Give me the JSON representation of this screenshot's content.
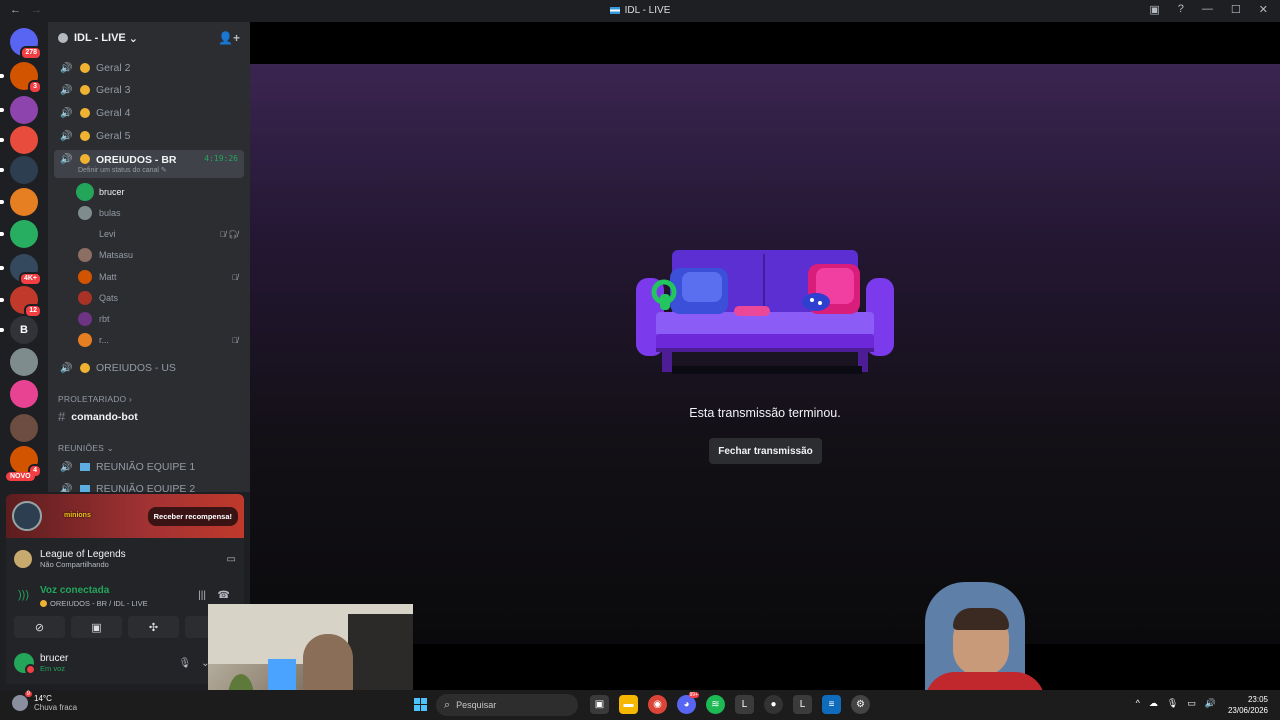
{
  "window": {
    "title": "IDL - LIVE",
    "back": "←",
    "forward": "→"
  },
  "servers": [
    {
      "label": "",
      "badge": "278",
      "color": "#5865f2"
    },
    {
      "label": "",
      "badge": "3",
      "color": "#d35400"
    },
    {
      "label": "",
      "badge": "",
      "color": "#8e44ad"
    },
    {
      "label": "",
      "badge": "",
      "color": "#e74c3c"
    },
    {
      "label": "",
      "badge": "",
      "color": "#2c3e50"
    },
    {
      "label": "",
      "badge": "",
      "color": "#e67e22"
    },
    {
      "label": "",
      "badge": "",
      "color": "#27ae60"
    },
    {
      "label": "",
      "badge": "4K+",
      "color": "#34495e"
    },
    {
      "label": "",
      "badge": "12",
      "color": "#c0392b"
    },
    {
      "label": "B",
      "badge": "",
      "color": "#313338"
    },
    {
      "label": "",
      "badge": "",
      "color": "#7f8c8d"
    },
    {
      "label": "",
      "badge": "",
      "color": "#e84393"
    },
    {
      "label": "",
      "badge": "",
      "color": "#6d4c41"
    },
    {
      "label": "",
      "badge": "4",
      "color": "#d35400"
    }
  ],
  "servers_new_label": "NOVO",
  "guild": {
    "name": "IDL - LIVE",
    "chevron": "⌄"
  },
  "voice_channels": [
    {
      "name": "Geral 2"
    },
    {
      "name": "Geral 3"
    },
    {
      "name": "Geral 4"
    },
    {
      "name": "Geral 5"
    }
  ],
  "active_channel": {
    "name": "OREIUDOS - BR",
    "timer": "4:19:26",
    "status_hint": "Definir um status do canal"
  },
  "members": [
    {
      "name": "brucer",
      "color": "#23a55a",
      "speaking": true,
      "mute": ""
    },
    {
      "name": "bulas",
      "color": "#7f8c8d",
      "speaking": false,
      "mute": ""
    },
    {
      "name": "Levi",
      "color": "#2b2d31",
      "speaking": false,
      "mute": "🎙̸ 🎧̸"
    },
    {
      "name": "Matsasu",
      "color": "#8d6e63",
      "speaking": false,
      "mute": ""
    },
    {
      "name": "Matt",
      "color": "#d35400",
      "speaking": false,
      "mute": "🎙̸"
    },
    {
      "name": "Qats",
      "color": "#a93226",
      "speaking": false,
      "mute": ""
    },
    {
      "name": "rbt",
      "color": "#6c3483",
      "speaking": false,
      "mute": ""
    },
    {
      "name": "r...",
      "color": "#e67e22",
      "speaking": false,
      "mute": "🎙̸"
    }
  ],
  "channel_us": {
    "name": "OREIUDOS - US"
  },
  "category_proletariado": "PROLETARIADO",
  "text_channel": "comando-bot",
  "category_reunioes": "REUNIÕES",
  "meeting_channels": [
    {
      "name": "REUNIÃO EQUIPE 1"
    },
    {
      "name": "REUNIÃO EQUIPE 2"
    }
  ],
  "promo": {
    "logo": "minions",
    "claim": "Receber recompensa!"
  },
  "activity": {
    "game": "League of Legends",
    "state": "Não Compartilhando"
  },
  "voice": {
    "title": "Voz conectada",
    "location": "OREIUDOS - BR / IDL - LIVE"
  },
  "user": {
    "name": "brucer",
    "status": "Em voz"
  },
  "stream": {
    "ended_text": "Esta transmissão terminou.",
    "close_label": "Fechar transmissão"
  },
  "taskbar": {
    "weather_badge": "9",
    "temp": "14°C",
    "weather_desc": "Chuva fraca",
    "search_placeholder": "Pesquisar",
    "time": "23:05",
    "date": "23/06/2026",
    "discord_badge": "99+"
  }
}
